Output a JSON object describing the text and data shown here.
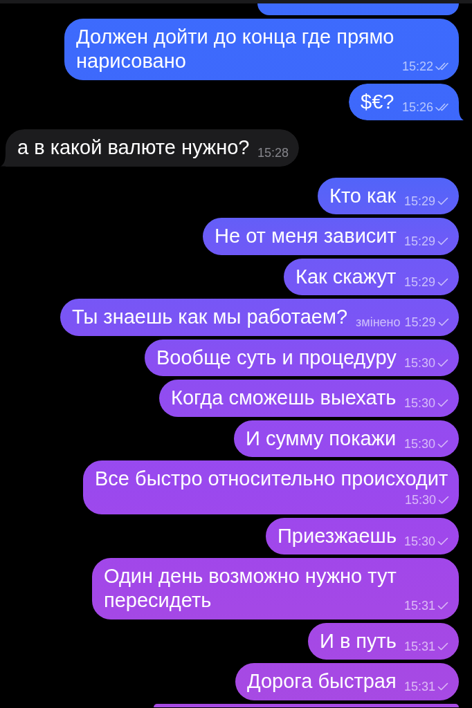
{
  "messages": [
    {
      "kind": "clipped"
    },
    {
      "kind": "outgoing",
      "text": "Должен дойти до конца где прямо нарисовано",
      "time": "15:22",
      "read": true,
      "tail": false
    },
    {
      "kind": "outgoing",
      "text": "$€?",
      "time": "15:26",
      "read": true,
      "tail": true
    },
    {
      "kind": "incoming",
      "text": "а в какой валюте нужно?",
      "time": "15:28",
      "tail": true
    },
    {
      "kind": "outgoing",
      "text": "Кто как",
      "time": "15:29",
      "read": false,
      "tail": false
    },
    {
      "kind": "outgoing",
      "text": "Не от меня зависит",
      "time": "15:29",
      "read": false,
      "tail": false
    },
    {
      "kind": "outgoing",
      "text": "Как скажут",
      "time": "15:29",
      "read": false,
      "tail": false
    },
    {
      "kind": "outgoing",
      "text": "Ты знаешь как мы работаем?",
      "edited_label": "змінено",
      "time": "15:29",
      "read": false,
      "tail": false
    },
    {
      "kind": "outgoing",
      "text": "Вообще суть и процедуру",
      "time": "15:30",
      "read": false,
      "tail": false
    },
    {
      "kind": "outgoing",
      "text": "Когда сможешь выехать",
      "time": "15:30",
      "read": false,
      "tail": false
    },
    {
      "kind": "outgoing",
      "text": "И сумму покажи",
      "time": "15:30",
      "read": false,
      "tail": false
    },
    {
      "kind": "outgoing",
      "text": "Все быстро относительно происходит",
      "time": "15:30",
      "read": false,
      "tail": false
    },
    {
      "kind": "outgoing",
      "text": "Приезжаешь",
      "time": "15:30",
      "read": false,
      "tail": false
    },
    {
      "kind": "outgoing",
      "text": "Один день возможно нужно тут пересидеть",
      "time": "15:31",
      "read": false,
      "tail": false
    },
    {
      "kind": "outgoing",
      "text": "И в путь",
      "time": "15:31",
      "read": false,
      "tail": false
    },
    {
      "kind": "outgoing",
      "text": "Дорога быстрая",
      "time": "15:31",
      "read": false,
      "tail": false
    },
    {
      "kind": "clipped"
    }
  ]
}
